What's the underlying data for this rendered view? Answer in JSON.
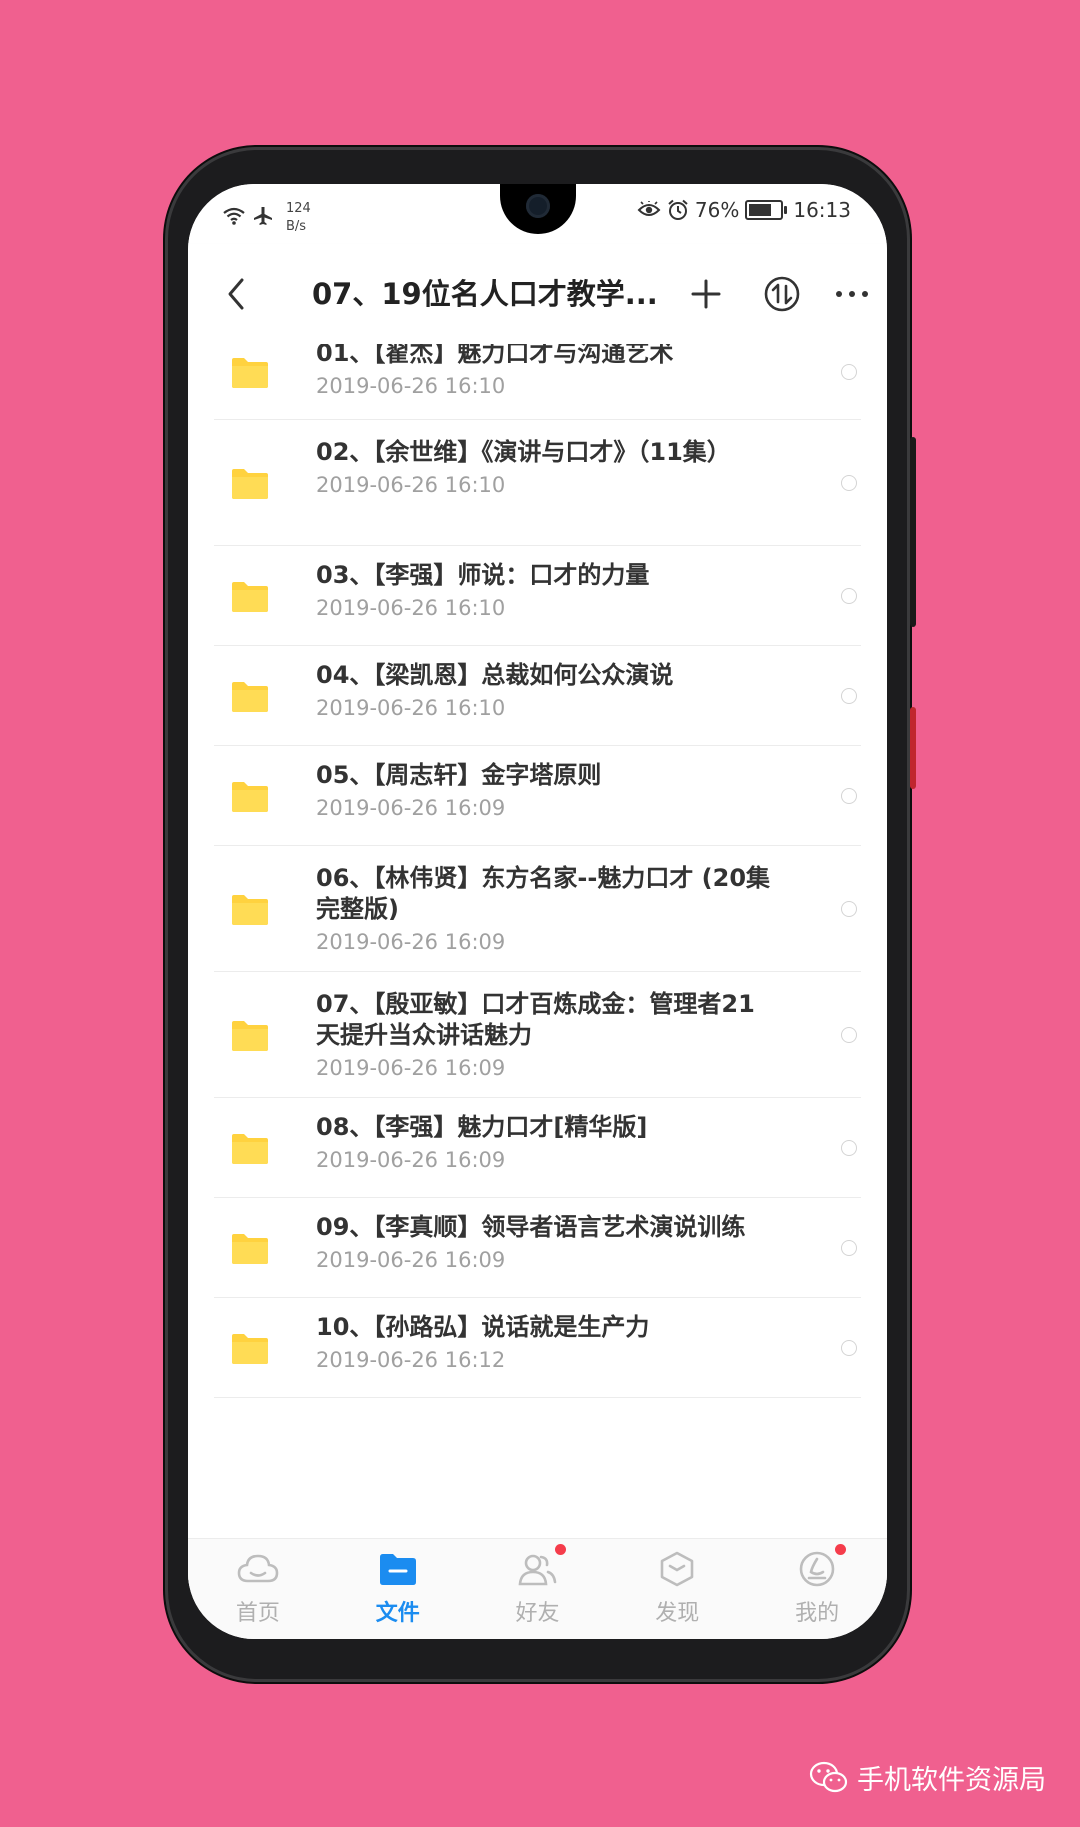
{
  "status_bar": {
    "network_speed_value": "124",
    "network_speed_unit": "B/s",
    "battery": "76%",
    "battery_level": 0.76,
    "time": "16:13"
  },
  "header": {
    "title": "07、19位名人口才教学..."
  },
  "files": [
    {
      "name": "01、【翟杰】魅力口才与沟通艺术",
      "date": "2019-06-26  16:10"
    },
    {
      "name": "02、【余世维】《演讲与口才》（11集）",
      "date": "2019-06-26  16:10"
    },
    {
      "name": "03、【李强】师说：口才的力量",
      "date": "2019-06-26  16:10"
    },
    {
      "name": "04、【梁凯恩】总裁如何公众演说",
      "date": "2019-06-26  16:10"
    },
    {
      "name": "05、【周志轩】金字塔原则",
      "date": "2019-06-26  16:09"
    },
    {
      "name": "06、【林伟贤】东方名家--魅力口才 (20集完整版)",
      "date": "2019-06-26  16:09"
    },
    {
      "name": "07、【殷亚敏】口才百炼成金：管理者21天提升当众讲话魅力",
      "date": "2019-06-26  16:09"
    },
    {
      "name": "08、【李强】魅力口才[精华版]",
      "date": "2019-06-26  16:09"
    },
    {
      "name": "09、【李真顺】领导者语言艺术演说训练",
      "date": "2019-06-26  16:09"
    },
    {
      "name": "10、【孙路弘】说话就是生产力",
      "date": "2019-06-26  16:12"
    }
  ],
  "tabs": [
    {
      "label": "首页",
      "icon": "cloud-icon",
      "active": false,
      "badge": false
    },
    {
      "label": "文件",
      "icon": "folder-icon",
      "active": true,
      "badge": false
    },
    {
      "label": "好友",
      "icon": "friends-icon",
      "active": false,
      "badge": true
    },
    {
      "label": "发现",
      "icon": "discover-icon",
      "active": false,
      "badge": false
    },
    {
      "label": "我的",
      "icon": "profile-icon",
      "active": false,
      "badge": true
    }
  ],
  "watermark": {
    "text": "手机软件资源局"
  },
  "colors": {
    "background": "#F0608F",
    "folder": "#FFD23F",
    "accent": "#1B8CF0",
    "badge": "#F53C4B"
  }
}
